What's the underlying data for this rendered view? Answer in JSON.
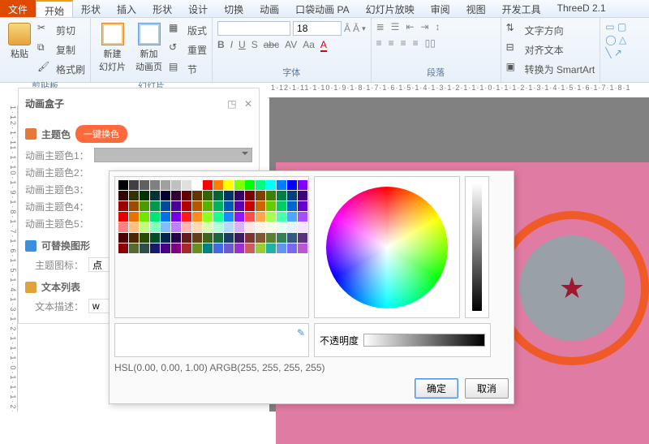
{
  "tabs": {
    "file": "文件",
    "items": [
      "开始",
      "形状",
      "插入",
      "形状",
      "设计",
      "切换",
      "动画",
      "口袋动画 PA",
      "幻灯片放映",
      "审阅",
      "视图",
      "开发工具",
      "ThreeD 2.1"
    ],
    "active": 0
  },
  "ribbon": {
    "clipboard": {
      "paste": "粘贴",
      "cut": "剪切",
      "copy": "复制",
      "brush": "格式刷",
      "label": "剪贴板"
    },
    "slides": {
      "newslide": "新建\n幻灯片",
      "newpage": "新加\n动画页",
      "layout": "版式",
      "reset": "重置",
      "section": "节",
      "label": "幻灯片"
    },
    "font": {
      "size": "18",
      "label": "字体",
      "btns": [
        "B",
        "I",
        "U",
        "S",
        "abc",
        "AV",
        "Aa",
        "A"
      ]
    },
    "para": {
      "label": "段落"
    },
    "right": {
      "textdir": "文字方向",
      "align": "对齐文本",
      "smartart": "转换为 SmartArt"
    }
  },
  "panel": {
    "title": "动画盒子",
    "sec_theme": "主题色",
    "badge": "一键换色",
    "rows": [
      "动画主题色1：",
      "动画主题色2：",
      "动画主题色3：",
      "动画主题色4：",
      "动画主题色5："
    ],
    "sec_shape": "可替换图形",
    "shape_label": "主题图标：",
    "shape_ph": "点",
    "sec_text": "文本列表",
    "text_label": "文本描述：",
    "text_val": "w"
  },
  "ruler": "1·12·1·11·1·10·1·9·1·8·1·7·1·6·1·5·1·4·1·3·1·2·1·1·1·0·1·1·1·2·1·3·1·4·1·5·1·6·1·7·1·8·1",
  "picker": {
    "opacity_label": "不透明度",
    "readout": "HSL(0.00, 0.00, 1.00)   ARGB(255, 255, 255, 255)",
    "ok": "确定",
    "cancel": "取消",
    "palette_rows": [
      [
        "#000",
        "#404040",
        "#606060",
        "#808080",
        "#a0a0a0",
        "#c0c0c0",
        "#e0e0e0",
        "#fff",
        "#f00",
        "#ff8000",
        "#ff0",
        "#80ff00",
        "#0f0",
        "#00ff80",
        "#0ff",
        "#0080ff",
        "#00f",
        "#8000ff"
      ],
      [
        "#330000",
        "#333300",
        "#003300",
        "#003333",
        "#000033",
        "#330033",
        "#660000",
        "#663300",
        "#336600",
        "#006633",
        "#003366",
        "#330066",
        "#800000",
        "#804000",
        "#408000",
        "#008040",
        "#004080",
        "#400080"
      ],
      [
        "#990000",
        "#994c00",
        "#4c9900",
        "#00994c",
        "#004c99",
        "#4c0099",
        "#b20000",
        "#b25900",
        "#59b200",
        "#00b259",
        "#0059b2",
        "#5900b2",
        "#cc0000",
        "#cc6600",
        "#66cc00",
        "#00cc66",
        "#0066cc",
        "#6600cc"
      ],
      [
        "#e60000",
        "#e67300",
        "#73e600",
        "#00e673",
        "#0073e6",
        "#7300e6",
        "#ff1a1a",
        "#ff8c1a",
        "#8cff1a",
        "#1aff8c",
        "#1a8cff",
        "#8c1aff",
        "#ff4d4d",
        "#ffa64d",
        "#a6ff4d",
        "#4dffa6",
        "#4da6ff",
        "#a64dff"
      ],
      [
        "#ff8080",
        "#ffbf80",
        "#bfff80",
        "#80ffbf",
        "#80bfff",
        "#bf80ff",
        "#ffb3b3",
        "#ffd9b3",
        "#d9ffb3",
        "#b3ffd9",
        "#b3d9ff",
        "#d9b3ff",
        "#ffe6e6",
        "#fff2e6",
        "#f2ffe6",
        "#e6fff2",
        "#e6f2ff",
        "#f2e6ff"
      ],
      [
        "#4d0000",
        "#4d2600",
        "#264d00",
        "#004d26",
        "#00264d",
        "#26004d",
        "#661a1a",
        "#663d1a",
        "#3d661a",
        "#1a663d",
        "#1a3d66",
        "#3d1a66",
        "#803333",
        "#805933",
        "#598033",
        "#338059",
        "#335980",
        "#593380"
      ],
      [
        "#8b0000",
        "#556b2f",
        "#2f4f4f",
        "#191970",
        "#4b0082",
        "#800080",
        "#a52a2a",
        "#6b8e23",
        "#008080",
        "#4169e1",
        "#6a5acd",
        "#9932cc",
        "#cd5c5c",
        "#9acd32",
        "#20b2aa",
        "#6495ed",
        "#7b68ee",
        "#ba55d3"
      ]
    ]
  },
  "chart_data": null
}
